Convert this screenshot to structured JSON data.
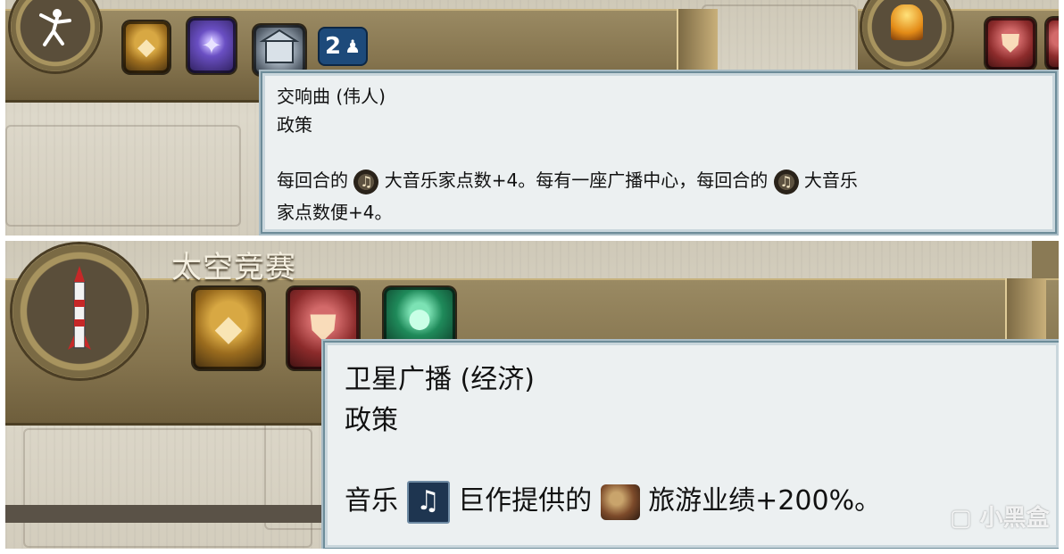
{
  "top": {
    "header_title": "",
    "badge": {
      "count": "2"
    },
    "tooltip": {
      "name": "交响曲 (伟人)",
      "type": "政策",
      "desc_part1": "每回合的",
      "desc_part2": "大音乐家点数+4。每有一座广播中心，每回合的",
      "desc_part3": "大音乐",
      "desc_part4": "家点数便+4。"
    }
  },
  "bottom": {
    "header_title": "太空竞赛",
    "tooltip": {
      "name": "卫星广播 (经济)",
      "type": "政策",
      "desc_part1": "音乐",
      "desc_part2": "巨作提供的",
      "desc_part3": "旅游业绩+200%。"
    }
  },
  "watermark": "小黑盒",
  "icons": {
    "music_note": "♫",
    "music_note_sq": "♫",
    "sparkle": "✦",
    "diamond": "◆",
    "shield": "⛊"
  },
  "colors": {
    "tooltip_bg": "#ecf0f1",
    "bar_gold": "#86754f",
    "badge_blue": "#1d4a7a"
  }
}
